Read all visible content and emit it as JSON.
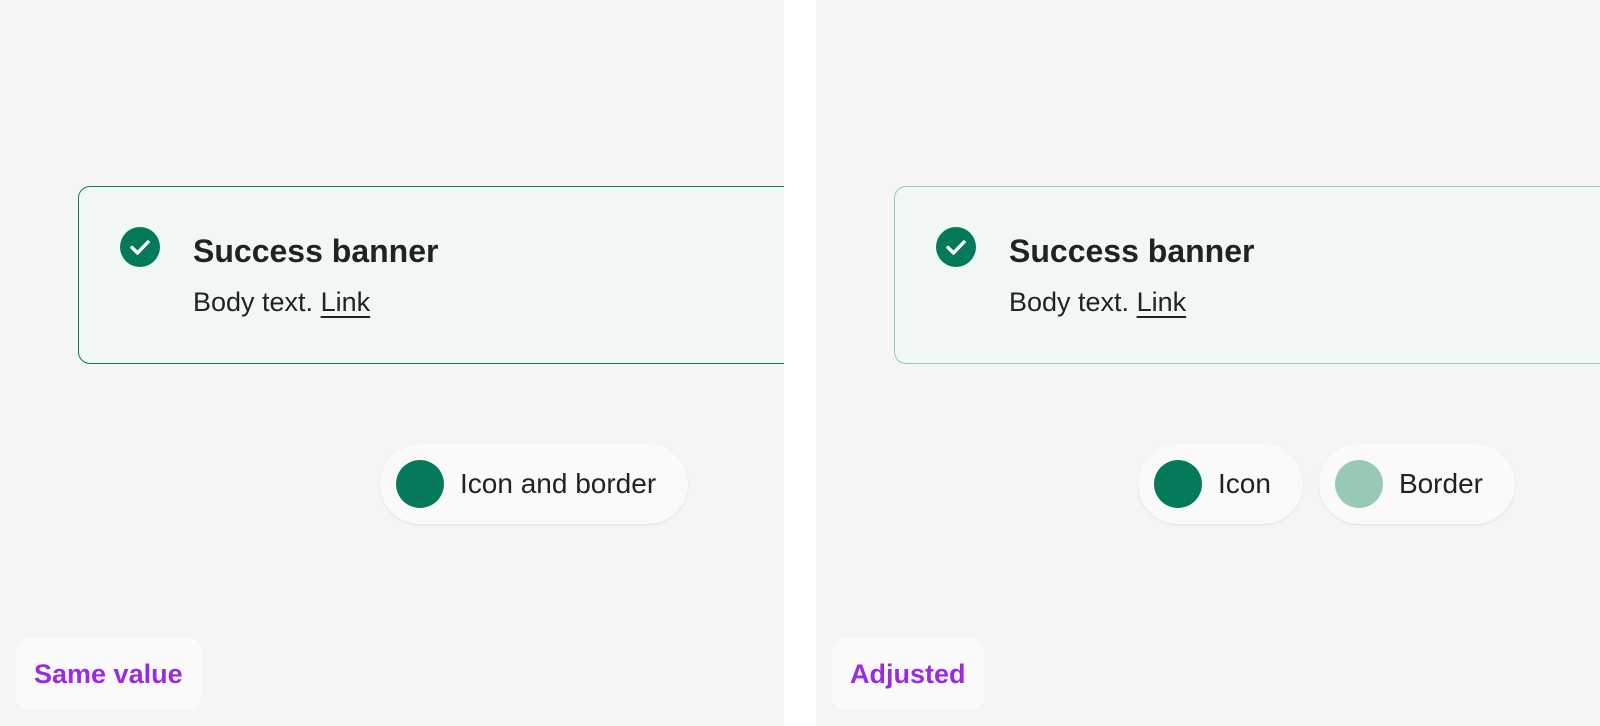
{
  "colors": {
    "panel_background": "#f5f5f5",
    "banner_background": "#f1f7f4",
    "icon_green": "#047a5a",
    "border_green_strong": "#0f7a57",
    "border_green_light": "#97c9b4",
    "label_purple": "#9a2be0"
  },
  "panels": [
    {
      "label": "Same value",
      "banner": {
        "icon": "check-circle-icon",
        "title": "Success banner",
        "body_text": "Body text.",
        "link_text": "Link"
      },
      "legend": [
        {
          "label": "Icon and border",
          "color": "#047a5a"
        }
      ]
    },
    {
      "label": "Adjusted",
      "banner": {
        "icon": "check-circle-icon",
        "title": "Success banner",
        "body_text": "Body text.",
        "link_text": "Link"
      },
      "legend": [
        {
          "label": "Icon",
          "color": "#047a5a"
        },
        {
          "label": "Border",
          "color": "#97c9b4"
        }
      ]
    }
  ]
}
